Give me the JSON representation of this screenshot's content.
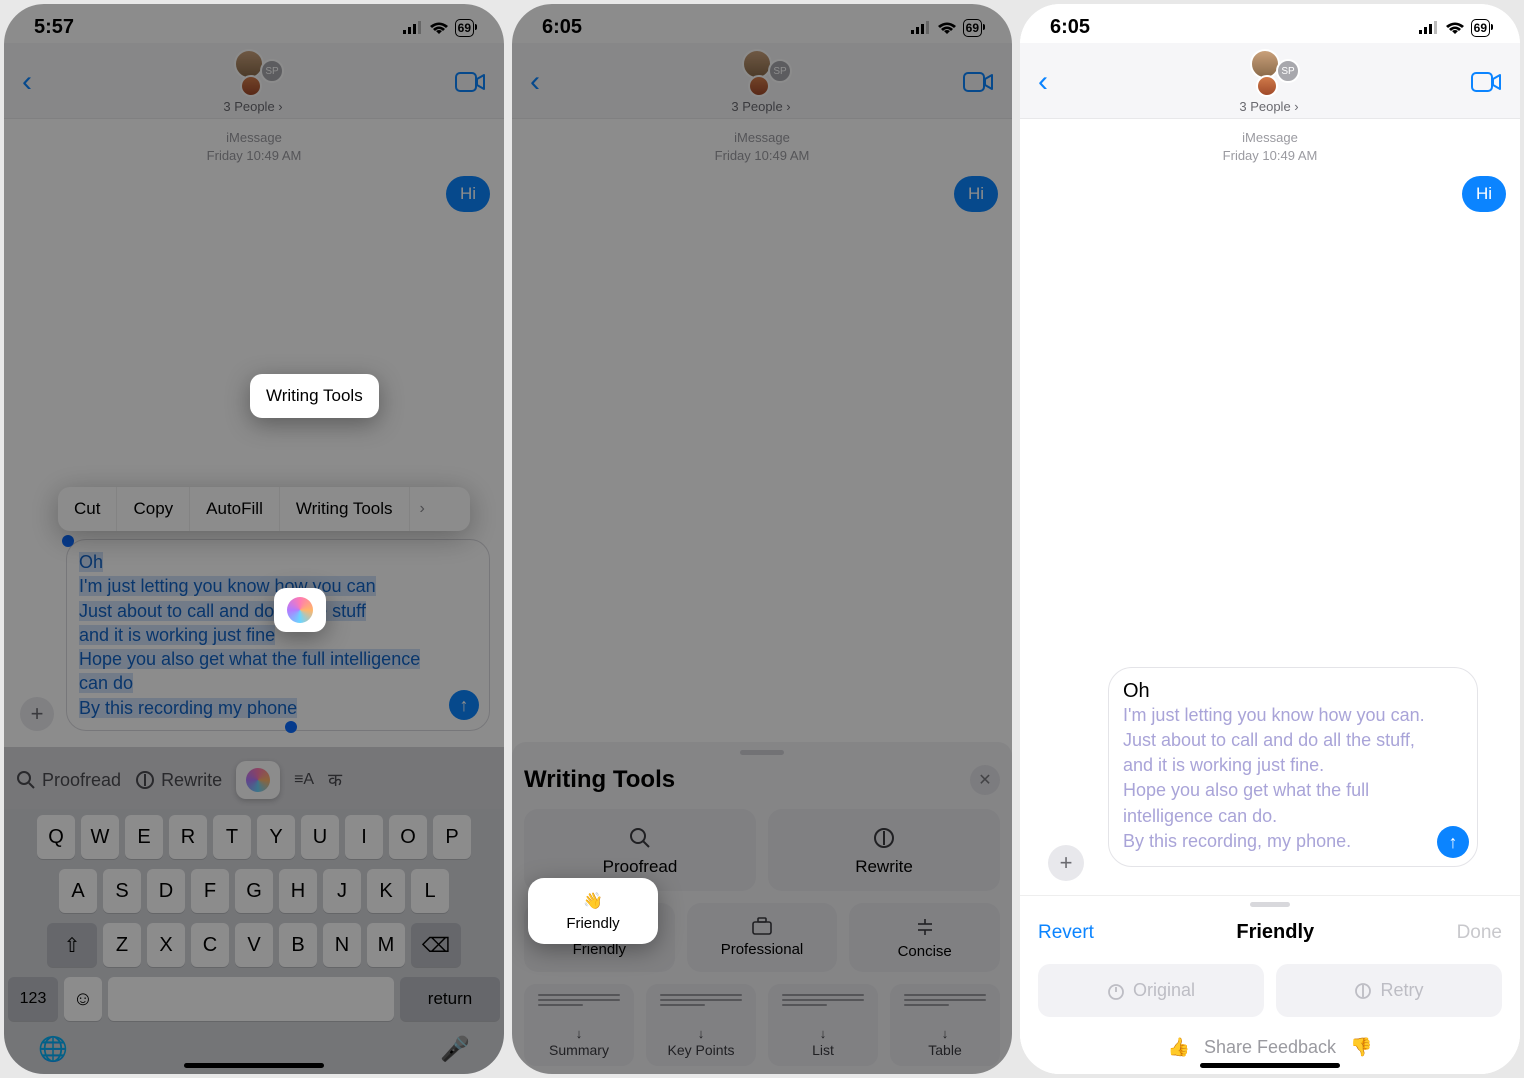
{
  "status": {
    "time1": "5:57",
    "time2": "6:05",
    "time3": "6:05",
    "battery": "69"
  },
  "header": {
    "contact_label": "3 People",
    "avatar_badge": "SP"
  },
  "thread": {
    "meta_service": "iMessage",
    "meta_time": "Friday 10:49 AM",
    "msg_hi": "Hi"
  },
  "draft1": "Oh\nI'm just letting you know how you can\nJust about to call and do all the stuff\nand it is working just fine\nHope you also get what the full intelligence can do\nBy this recording my phone",
  "draft2": "Oh\nI'm just letting you know how you can.\nJust about to call and do all the stuff,\nand it is working just fine.\nHope you also get what the full intelligence can do.\nBy this recording, my phone.",
  "ctx": {
    "cut": "Cut",
    "copy": "Copy",
    "autofill": "AutoFill",
    "writing_tools": "Writing Tools"
  },
  "suggest": {
    "proofread": "Proofread",
    "rewrite": "Rewrite"
  },
  "keyboard": {
    "r1": [
      "Q",
      "W",
      "E",
      "R",
      "T",
      "Y",
      "U",
      "I",
      "O",
      "P"
    ],
    "r2": [
      "A",
      "S",
      "D",
      "F",
      "G",
      "H",
      "J",
      "K",
      "L"
    ],
    "r3": [
      "Z",
      "X",
      "C",
      "V",
      "B",
      "N",
      "M"
    ],
    "num": "123",
    "return": "return"
  },
  "sheet": {
    "title": "Writing Tools",
    "proofread": "Proofread",
    "rewrite": "Rewrite",
    "friendly": "Friendly",
    "professional": "Professional",
    "concise": "Concise",
    "summary": "Summary",
    "keypoints": "Key Points",
    "list": "List",
    "table": "Table"
  },
  "p3_draft": {
    "first": "Oh",
    "rest": "I'm just letting you know how you can.\nJust about to call and do all the stuff,\nand it is working just fine.\nHope you also get what the full intelligence can do.\nBy this recording, my phone."
  },
  "review": {
    "revert": "Revert",
    "title": "Friendly",
    "done": "Done",
    "original": "Original",
    "retry": "Retry",
    "feedback": "Share Feedback"
  }
}
